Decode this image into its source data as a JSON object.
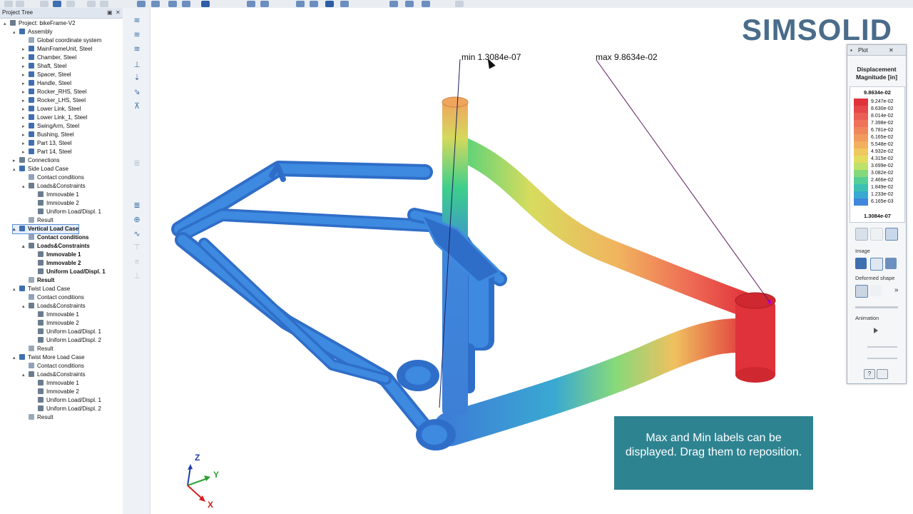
{
  "tree": {
    "header": "Project Tree",
    "items": [
      {
        "label": "Project: bikeFrame-V2",
        "level": 0,
        "expander": "▴",
        "icon": "project-icon",
        "bold": false
      },
      {
        "label": "Assembly",
        "level": 1,
        "expander": "▴",
        "icon": "assembly-icon",
        "bold": false
      },
      {
        "label": "Global coordinate system",
        "level": 2,
        "expander": "",
        "icon": "coordinate-system-icon",
        "bold": false
      },
      {
        "label": "MainFrameUnit, Steel",
        "level": 2,
        "expander": "▸",
        "icon": "part-icon",
        "bold": false
      },
      {
        "label": "Chamber, Steel",
        "level": 2,
        "expander": "▸",
        "icon": "part-icon",
        "bold": false
      },
      {
        "label": "Shaft, Steel",
        "level": 2,
        "expander": "▸",
        "icon": "part-icon",
        "bold": false
      },
      {
        "label": "Spacer, Steel",
        "level": 2,
        "expander": "▸",
        "icon": "part-icon",
        "bold": false
      },
      {
        "label": "Handle, Steel",
        "level": 2,
        "expander": "▸",
        "icon": "part-icon",
        "bold": false
      },
      {
        "label": "Rocker_RHS, Steel",
        "level": 2,
        "expander": "▸",
        "icon": "part-icon",
        "bold": false
      },
      {
        "label": "Rocker_LHS, Steel",
        "level": 2,
        "expander": "▸",
        "icon": "part-icon",
        "bold": false
      },
      {
        "label": "Lower Link, Steel",
        "level": 2,
        "expander": "▸",
        "icon": "part-icon",
        "bold": false
      },
      {
        "label": "Lower Link_1, Steel",
        "level": 2,
        "expander": "▸",
        "icon": "part-icon",
        "bold": false
      },
      {
        "label": "SwingArm, Steel",
        "level": 2,
        "expander": "▸",
        "icon": "part-icon",
        "bold": false
      },
      {
        "label": "Bushing, Steel",
        "level": 2,
        "expander": "▸",
        "icon": "part-icon",
        "bold": false
      },
      {
        "label": "Part 13, Steel",
        "level": 2,
        "expander": "▸",
        "icon": "part-icon",
        "bold": false
      },
      {
        "label": "Part 14, Steel",
        "level": 2,
        "expander": "▸",
        "icon": "part-icon",
        "bold": false
      },
      {
        "label": "Connections",
        "level": 1,
        "expander": "▸",
        "icon": "connections-icon",
        "bold": false
      },
      {
        "label": "Side Load Case",
        "level": 1,
        "expander": "▴",
        "icon": "load-case-icon",
        "bold": false
      },
      {
        "label": "Contact conditions",
        "level": 2,
        "expander": "",
        "icon": "contact-icon",
        "bold": false
      },
      {
        "label": "Loads&Constraints",
        "level": 2,
        "expander": "▴",
        "icon": "loads-icon",
        "bold": false
      },
      {
        "label": "Immovable 1",
        "level": 3,
        "expander": "",
        "icon": "immovable-icon",
        "bold": false
      },
      {
        "label": "Immovable 2",
        "level": 3,
        "expander": "",
        "icon": "immovable-icon",
        "bold": false
      },
      {
        "label": "Uniform Load/Displ. 1",
        "level": 3,
        "expander": "",
        "icon": "uniform-load-icon",
        "bold": false
      },
      {
        "label": "Result",
        "level": 2,
        "expander": "",
        "icon": "result-icon",
        "bold": false
      },
      {
        "label": "Vertical Load Case",
        "level": 1,
        "expander": "▴",
        "icon": "load-case-icon",
        "bold": true,
        "selected": true
      },
      {
        "label": "Contact conditions",
        "level": 2,
        "expander": "",
        "icon": "contact-icon",
        "bold": true
      },
      {
        "label": "Loads&Constraints",
        "level": 2,
        "expander": "▴",
        "icon": "loads-icon",
        "bold": true
      },
      {
        "label": "Immovable 1",
        "level": 3,
        "expander": "",
        "icon": "immovable-icon",
        "bold": true
      },
      {
        "label": "Immovable 2",
        "level": 3,
        "expander": "",
        "icon": "immovable-icon",
        "bold": true
      },
      {
        "label": "Uniform Load/Displ. 1",
        "level": 3,
        "expander": "",
        "icon": "uniform-load-icon",
        "bold": true
      },
      {
        "label": "Result",
        "level": 2,
        "expander": "",
        "icon": "result-icon",
        "bold": true
      },
      {
        "label": "Twist Load Case",
        "level": 1,
        "expander": "▴",
        "icon": "load-case-icon",
        "bold": false
      },
      {
        "label": "Contact conditions",
        "level": 2,
        "expander": "",
        "icon": "contact-icon",
        "bold": false
      },
      {
        "label": "Loads&Constraints",
        "level": 2,
        "expander": "▴",
        "icon": "loads-icon",
        "bold": false
      },
      {
        "label": "Immovable 1",
        "level": 3,
        "expander": "",
        "icon": "immovable-icon",
        "bold": false
      },
      {
        "label": "Immovable 2",
        "level": 3,
        "expander": "",
        "icon": "immovable-icon",
        "bold": false
      },
      {
        "label": "Uniform Load/Displ. 1",
        "level": 3,
        "expander": "",
        "icon": "uniform-load-icon",
        "bold": false
      },
      {
        "label": "Uniform Load/Displ. 2",
        "level": 3,
        "expander": "",
        "icon": "uniform-load-icon",
        "bold": false
      },
      {
        "label": "Result",
        "level": 2,
        "expander": "",
        "icon": "result-icon",
        "bold": false
      },
      {
        "label": "Twist More Load Case",
        "level": 1,
        "expander": "▴",
        "icon": "load-case-icon",
        "bold": false
      },
      {
        "label": "Contact conditions",
        "level": 2,
        "expander": "",
        "icon": "contact-icon",
        "bold": false
      },
      {
        "label": "Loads&Constraints",
        "level": 2,
        "expander": "▴",
        "icon": "loads-icon",
        "bold": false
      },
      {
        "label": "Immovable 1",
        "level": 3,
        "expander": "",
        "icon": "immovable-icon",
        "bold": false
      },
      {
        "label": "Immovable 2",
        "level": 3,
        "expander": "",
        "icon": "immovable-icon",
        "bold": false
      },
      {
        "label": "Uniform Load/Displ. 1",
        "level": 3,
        "expander": "",
        "icon": "uniform-load-icon",
        "bold": false
      },
      {
        "label": "Uniform Load/Displ. 2",
        "level": 3,
        "expander": "",
        "icon": "uniform-load-icon",
        "bold": false
      },
      {
        "label": "Result",
        "level": 2,
        "expander": "",
        "icon": "result-icon",
        "bold": false
      }
    ]
  },
  "brand": "SIMSOLID",
  "viewport": {
    "min_label": "min  1.3084e-07",
    "max_label": "max  9.8634e-02",
    "axes": {
      "z": "Z",
      "y": "Y",
      "x": "X"
    },
    "callout": "Max and Min labels can be displayed.  Drag them to reposition."
  },
  "plot_panel": {
    "tab_label": "Plot",
    "title_line1": "Displacement",
    "title_line2": "Magnitude [in]",
    "legend_max": "9.8634e-02",
    "legend_min": "1.3084e-07",
    "legend": [
      {
        "value": "9.247e-02",
        "color": "#e0323a"
      },
      {
        "value": "8.630e-02",
        "color": "#e6474a"
      },
      {
        "value": "8.014e-02",
        "color": "#ea5f55"
      },
      {
        "value": "7.398e-02",
        "color": "#ee7359"
      },
      {
        "value": "6.781e-02",
        "color": "#f0875c"
      },
      {
        "value": "6.165e-02",
        "color": "#f19b5e"
      },
      {
        "value": "5.548e-02",
        "color": "#f2b15f"
      },
      {
        "value": "4.932e-02",
        "color": "#efc85f"
      },
      {
        "value": "4.315e-02",
        "color": "#e4dc5f"
      },
      {
        "value": "3.699e-02",
        "color": "#bde16a"
      },
      {
        "value": "3.082e-02",
        "color": "#86d97b"
      },
      {
        "value": "2.466e-02",
        "color": "#55cf95"
      },
      {
        "value": "1.849e-02",
        "color": "#3dc1b4"
      },
      {
        "value": "1.233e-02",
        "color": "#3aa9d2"
      },
      {
        "value": "6.165e-03",
        "color": "#3f86dc"
      }
    ],
    "section_image": "Image",
    "section_deformed": "Deformed shape",
    "section_animation": "Animation",
    "more_label": "»"
  },
  "colors": {
    "callout": "#2e8391",
    "brand": "#4a6c8a",
    "frame_low": "#3d7fd6",
    "frame_high": "#e0323a"
  }
}
